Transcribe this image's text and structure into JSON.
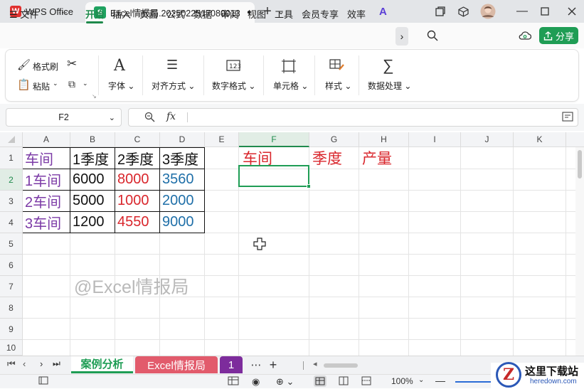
{
  "titlebar": {
    "app_tab": "WPS Office",
    "doc_tab": "Excel情报局.20250225170800130",
    "doc_modified_dot": "●",
    "new_tab": "+",
    "dropdown": "⌄"
  },
  "menu": {
    "file": "文件",
    "more": "⋯",
    "items": [
      "开始",
      "插入",
      "页面",
      "公式",
      "数据",
      "审阅",
      "视图",
      "工具",
      "会员专享",
      "效率"
    ],
    "share": "分享"
  },
  "ribbon": {
    "format_painter": "格式刷",
    "paste": "粘贴",
    "font": "字体",
    "alignment": "对齐方式",
    "number_format": "数字格式",
    "cells": "单元格",
    "styles": "样式",
    "data_processing": "数据处理"
  },
  "formula_bar": {
    "name_box": "F2",
    "formula": ""
  },
  "grid": {
    "columns": [
      "A",
      "B",
      "C",
      "D",
      "E",
      "F",
      "G",
      "H",
      "I",
      "J",
      "K"
    ],
    "selected_column": "F",
    "rows": [
      "1",
      "2",
      "3",
      "4",
      "5",
      "6",
      "7",
      "8",
      "9",
      "10"
    ],
    "selected_row": "2",
    "table": [
      [
        "车间",
        "1季度",
        "2季度",
        "3季度"
      ],
      [
        "1车间",
        "6000",
        "8000",
        "3560"
      ],
      [
        "2车间",
        "5000",
        "1000",
        "2000"
      ],
      [
        "3车间",
        "1200",
        "4550",
        "9000"
      ]
    ],
    "headers_right": [
      "车间",
      "季度",
      "产量"
    ],
    "watermark": "@Excel情报局"
  },
  "colors": {
    "purple": "#7b3aa6",
    "black": "#111111",
    "red": "#d9262c",
    "blue": "#1f6fa8",
    "accent": "#1f9d55"
  },
  "sheets": {
    "tabs": [
      "案例分析",
      "Excel情报局",
      "1"
    ],
    "more": "⋯",
    "add": "+"
  },
  "status": {
    "zoom": "100%"
  },
  "badge": {
    "title": "这里下载站",
    "url": "heredown.com",
    "mark": "Z"
  }
}
